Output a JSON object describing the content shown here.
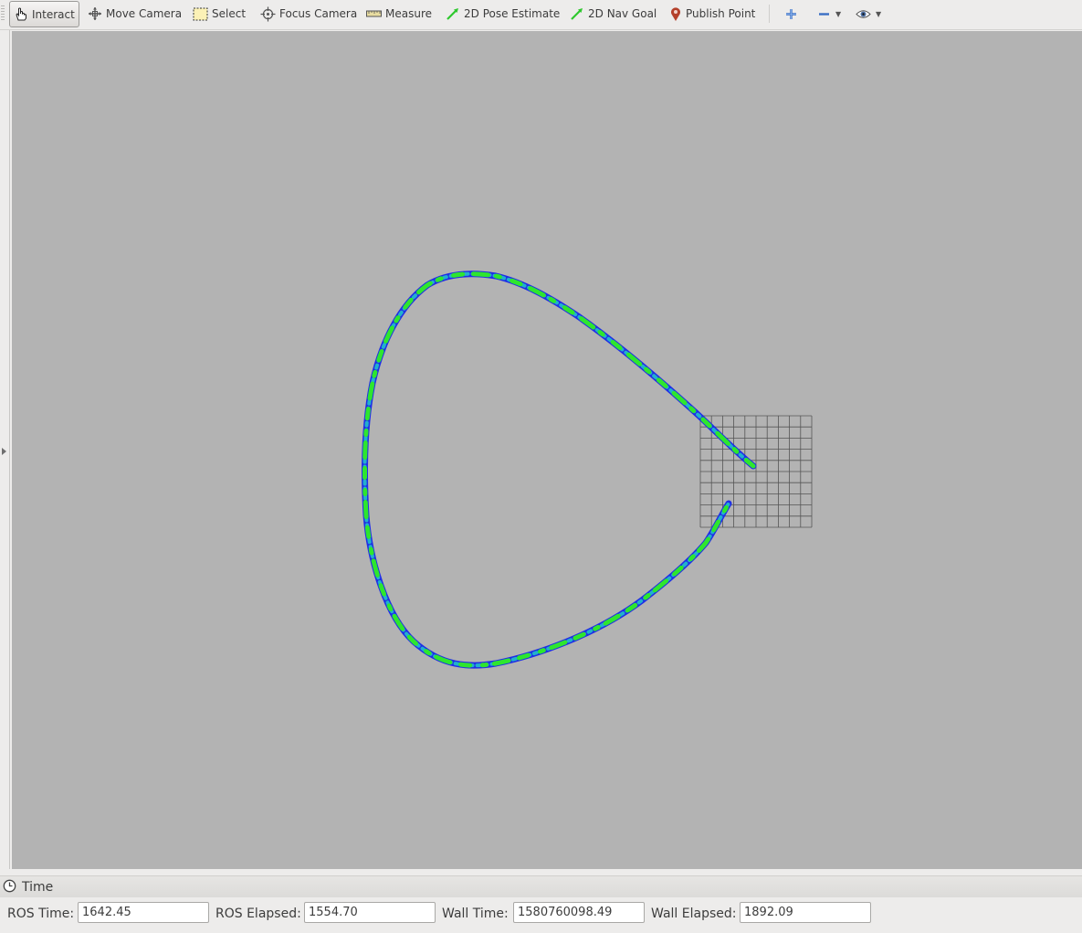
{
  "toolbar": {
    "tools": [
      {
        "label": "Interact",
        "icon": "hand-pointer-icon",
        "active": true
      },
      {
        "label": "Move Camera",
        "icon": "move-arrows-icon"
      },
      {
        "label": "Select",
        "icon": "dashed-rectangle-icon"
      },
      {
        "label": "Focus Camera",
        "icon": "crosshair-icon"
      },
      {
        "label": "Measure",
        "icon": "ruler-icon"
      },
      {
        "label": "2D Pose Estimate",
        "icon": "green-arrow-icon",
        "color": "#2ec82e"
      },
      {
        "label": "2D Nav Goal",
        "icon": "green-arrow-icon",
        "color": "#2ec82e"
      },
      {
        "label": "Publish Point",
        "icon": "map-pin-icon",
        "color": "#b4402a"
      }
    ],
    "extra_icons": [
      "add-tool-icon",
      "remove-tool-icon",
      "eye-visibility-icon"
    ]
  },
  "viewport": {
    "background": "#b3b3b3",
    "trajectory_colors": [
      "#1f2ee6",
      "#2ee62e",
      "#22b0cc"
    ],
    "grid": {
      "rows": 10,
      "cols": 10
    }
  },
  "time_panel": {
    "title": "Time",
    "fields": {
      "ros_time": {
        "label": "ROS Time:",
        "value": "1642.45"
      },
      "ros_elapsed": {
        "label": "ROS Elapsed:",
        "value": "1554.70"
      },
      "wall_time": {
        "label": "Wall Time:",
        "value": "1580760098.49"
      },
      "wall_elapsed": {
        "label": "Wall Elapsed:",
        "value": "1892.09"
      }
    }
  }
}
